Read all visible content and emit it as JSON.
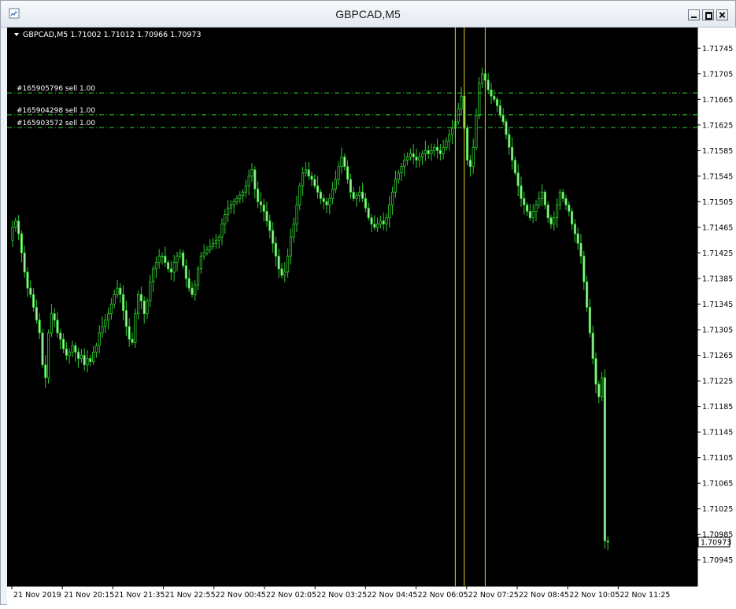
{
  "window": {
    "title": "GBPCAD,M5"
  },
  "chart_data": {
    "type": "candlestick",
    "header": "GBPCAD,M5  1.71002 1.71012 1.70966 1.70973",
    "symbol": "GBPCAD",
    "timeframe": "M5",
    "last_price": "1.70973",
    "ylim": [
      1.70925,
      1.71765
    ],
    "y_ticks": [
      "1.71745",
      "1.71705",
      "1.71665",
      "1.71625",
      "1.71585",
      "1.71545",
      "1.71505",
      "1.71465",
      "1.71425",
      "1.71385",
      "1.71345",
      "1.71305",
      "1.71265",
      "1.71225",
      "1.71185",
      "1.71145",
      "1.71105",
      "1.71065",
      "1.71025",
      "1.70985",
      "1.70945"
    ],
    "x_ticks": [
      "21 Nov 2019",
      "21 Nov 20:15",
      "21 Nov 21:35",
      "21 Nov 22:55",
      "22 Nov 00:45",
      "22 Nov 02:05",
      "22 Nov 03:25",
      "22 Nov 04:45",
      "22 Nov 06:05",
      "22 Nov 07:25",
      "22 Nov 08:45",
      "22 Nov 10:05",
      "22 Nov 11:25"
    ],
    "orders": [
      {
        "label": "#165905796 sell 1.00",
        "price": 1.71675
      },
      {
        "label": "#165904298 sell 1.00",
        "price": 1.71641
      },
      {
        "label": "#165903572 sell 1.00",
        "price": 1.71621
      }
    ],
    "vertical_markers_bar_index": [
      148,
      151,
      158
    ],
    "series_closes": [
      1.71465,
      1.71475,
      1.71455,
      1.71425,
      1.71395,
      1.7137,
      1.7136,
      1.7134,
      1.7132,
      1.713,
      1.7125,
      1.7123,
      1.713,
      1.7133,
      1.7132,
      1.713,
      1.7129,
      1.71275,
      1.71265,
      1.7127,
      1.7128,
      1.7127,
      1.7126,
      1.71265,
      1.7125,
      1.7126,
      1.71255,
      1.7127,
      1.7128,
      1.713,
      1.7131,
      1.7132,
      1.7133,
      1.71345,
      1.7136,
      1.7137,
      1.7136,
      1.71335,
      1.7131,
      1.7129,
      1.71285,
      1.7133,
      1.7136,
      1.7135,
      1.7133,
      1.7135,
      1.7138,
      1.714,
      1.7141,
      1.7142,
      1.7142,
      1.7141,
      1.714,
      1.71395,
      1.7141,
      1.7142,
      1.71425,
      1.71405,
      1.71385,
      1.7137,
      1.7136,
      1.71375,
      1.714,
      1.7142,
      1.71425,
      1.7143,
      1.71435,
      1.7144,
      1.71445,
      1.7145,
      1.7147,
      1.71485,
      1.71495,
      1.715,
      1.71505,
      1.7151,
      1.71515,
      1.7152,
      1.7153,
      1.71545,
      1.71555,
      1.71525,
      1.71505,
      1.715,
      1.7149,
      1.71475,
      1.7146,
      1.7144,
      1.7142,
      1.714,
      1.7139,
      1.71395,
      1.7142,
      1.7145,
      1.7147,
      1.715,
      1.7153,
      1.7155,
      1.71555,
      1.71545,
      1.7154,
      1.7153,
      1.7152,
      1.7151,
      1.71505,
      1.715,
      1.7151,
      1.71525,
      1.7154,
      1.7156,
      1.71575,
      1.7156,
      1.7154,
      1.7152,
      1.7151,
      1.71515,
      1.7152,
      1.7151,
      1.71495,
      1.7148,
      1.7147,
      1.71465,
      1.7147,
      1.71475,
      1.7147,
      1.7148,
      1.715,
      1.7152,
      1.7154,
      1.7155,
      1.7156,
      1.7157,
      1.71575,
      1.7158,
      1.71575,
      1.7157,
      1.71575,
      1.7158,
      1.71585,
      1.7158,
      1.71585,
      1.7159,
      1.71585,
      1.7158,
      1.7159,
      1.716,
      1.7161,
      1.7162,
      1.7163,
      1.7165,
      1.7167,
      1.7162,
      1.7157,
      1.7156,
      1.7159,
      1.7164,
      1.7169,
      1.71705,
      1.71695,
      1.7168,
      1.7167,
      1.71665,
      1.71655,
      1.7164,
      1.7163,
      1.7161,
      1.7159,
      1.7157,
      1.7155,
      1.7153,
      1.7151,
      1.715,
      1.7149,
      1.7148,
      1.7149,
      1.715,
      1.7151,
      1.7152,
      1.715,
      1.7148,
      1.7147,
      1.7148,
      1.715,
      1.7152,
      1.7151,
      1.715,
      1.7149,
      1.7147,
      1.71455,
      1.7144,
      1.7142,
      1.7138,
      1.7134,
      1.713,
      1.7126,
      1.7122,
      1.712,
      1.7123,
      1.70975,
      1.70973
    ]
  }
}
